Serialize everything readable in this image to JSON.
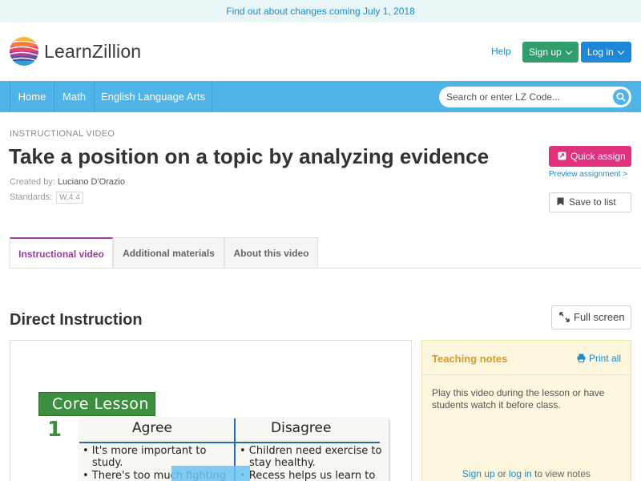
{
  "announcement": "Find out about changes coming July 1, 2018",
  "brand": {
    "name": "LearnZillion"
  },
  "header": {
    "help": "Help",
    "signup": "Sign up",
    "login": "Log in"
  },
  "nav": {
    "items": [
      "Home",
      "Math",
      "English Language Arts"
    ],
    "search_placeholder": "Search or enter LZ Code..."
  },
  "lesson": {
    "type": "INSTRUCTIONAL VIDEO",
    "title": "Take a position on a topic by analyzing evidence",
    "created_label": "Created by:",
    "author": "Luciano D'Orazio",
    "standards_label": "Standards:",
    "standard": "W.4.4"
  },
  "actions": {
    "quick_assign": "Quick assign",
    "preview": "Preview assignment >",
    "save": "Save to list"
  },
  "tabs": [
    "Instructional video",
    "Additional materials",
    "About this video"
  ],
  "section": {
    "title": "Direct Instruction",
    "fullscreen": "Full screen"
  },
  "video": {
    "tag": "Core Lesson",
    "number": "1",
    "columns": [
      "Agree",
      "Disagree"
    ],
    "agree_lines": [
      "• It's more important to",
      "study.",
      "• There's too much fighting"
    ],
    "disagree_lines": [
      "• Children need exercise to",
      "stay healthy.",
      "• Recess helps us learn to"
    ]
  },
  "notes": {
    "title": "Teaching notes",
    "print": "Print all",
    "body": "Play this video during the lesson or have students watch it before class.",
    "footer": {
      "signup": "Sign up",
      "or": "or",
      "login": "log in",
      "rest": "to view notes"
    }
  },
  "colors": {
    "nav": "#4fb5e8",
    "signup": "#2f9e6c",
    "login": "#1e88d6",
    "quick_assign": "#e0317f",
    "active_tab": "#9b3aa0",
    "notes_title": "#d89a2a"
  }
}
